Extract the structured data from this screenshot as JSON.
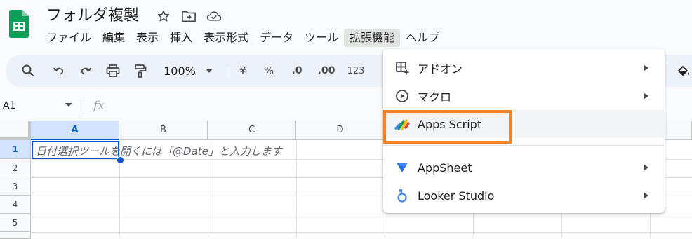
{
  "doc": {
    "title": "フォルダ複製"
  },
  "menubar": [
    "ファイル",
    "編集",
    "表示",
    "挿入",
    "表示形式",
    "データ",
    "ツール",
    "拡張機能",
    "ヘルプ"
  ],
  "toolbar": {
    "zoom": "100%",
    "currency": "¥",
    "percent": "%",
    "dec_decrease": ".0",
    "dec_increase": ".00",
    "number_format": "123"
  },
  "formula_bar": {
    "cell_ref": "A1",
    "fx": "fx"
  },
  "grid": {
    "columns": [
      "A",
      "B",
      "C",
      "D"
    ],
    "rows": [
      "1",
      "2",
      "3",
      "4",
      "5"
    ],
    "a1_hint": "日付選択ツールを開くには「@Date」と入力します"
  },
  "extensions_menu": {
    "items": [
      {
        "label": "アドオン",
        "icon": "addon-icon",
        "submenu": true
      },
      {
        "label": "マクロ",
        "icon": "play-circle-icon",
        "submenu": true
      },
      {
        "label": "Apps Script",
        "icon": "apps-script-icon",
        "submenu": false
      },
      {
        "label": "AppSheet",
        "icon": "appsheet-icon",
        "submenu": true
      },
      {
        "label": "Looker Studio",
        "icon": "looker-studio-icon",
        "submenu": true
      }
    ]
  },
  "colors": {
    "accent": "#0b57d0",
    "highlight": "#f0822a",
    "sheets_green": "#0f9d58"
  }
}
